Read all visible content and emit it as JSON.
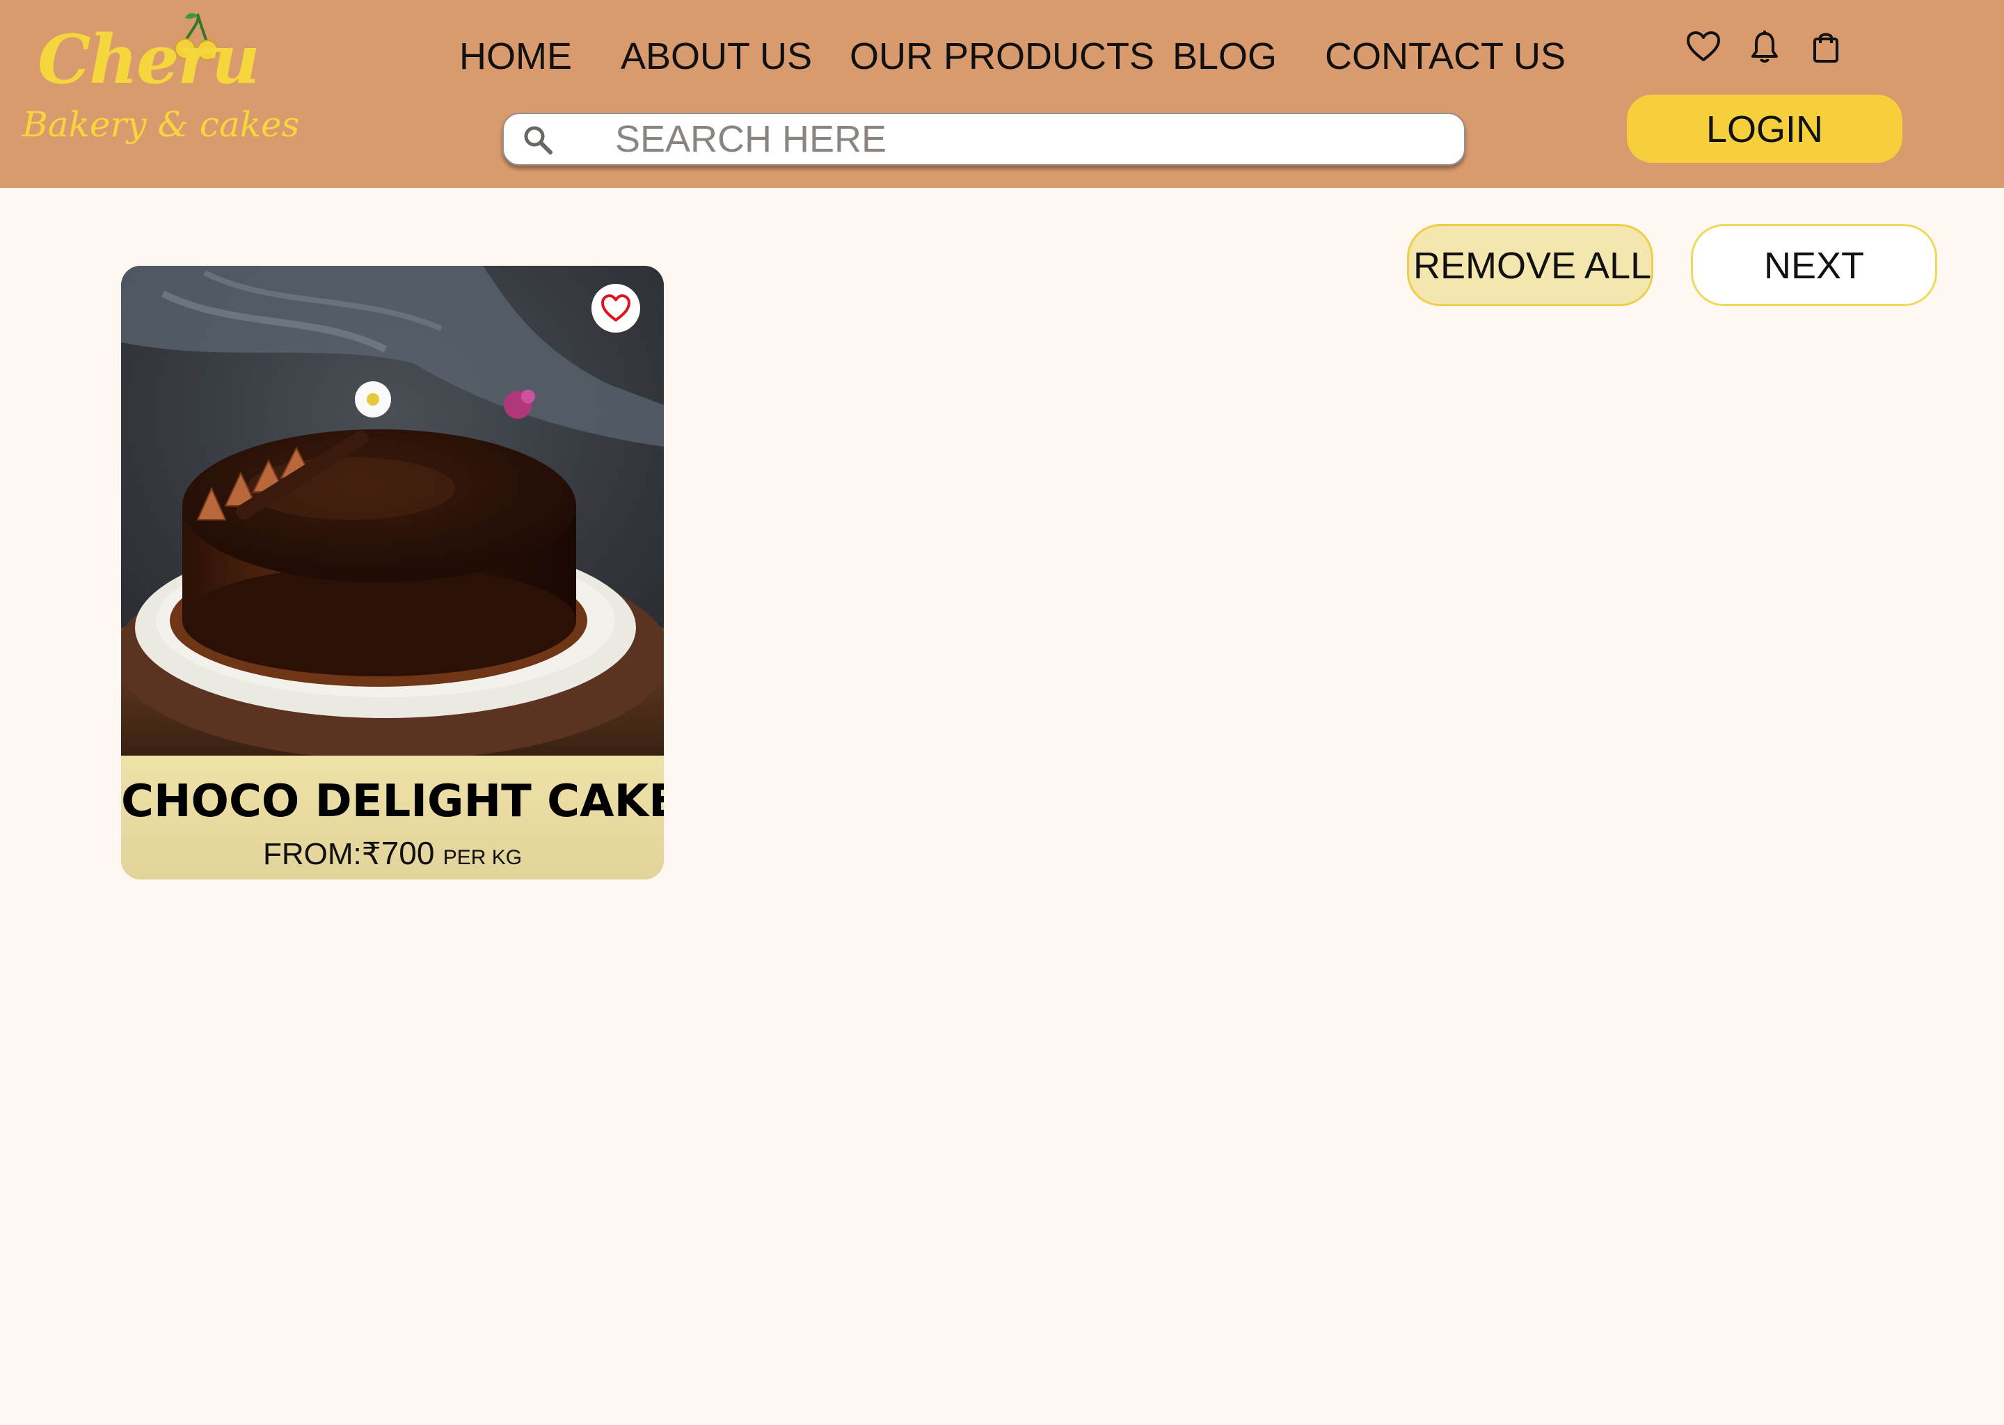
{
  "brand": {
    "name": "Cheru",
    "tagline": "Bakery & cakes",
    "primary_color": "#f5d63d"
  },
  "header": {
    "background": "#d99b6e",
    "nav": [
      "HOME",
      "ABOUT US",
      "OUR PRODUCTS",
      "BLOG",
      "CONTACT US"
    ],
    "search_placeholder": "SEARCH HERE",
    "icons": [
      "heart-icon",
      "bell-icon",
      "shopping-bag-icon"
    ],
    "login_label": "LOGIN"
  },
  "actions": {
    "remove_all_label": "REMOVE ALL",
    "next_label": "NEXT"
  },
  "wishlist": [
    {
      "title": "CHOCO DELIGHT CAKE",
      "price_prefix": "FROM:",
      "currency": "₹",
      "price": "700",
      "unit": "PER KG",
      "favorited": true,
      "image": "chocolate-glazed-cake-photo"
    }
  ]
}
